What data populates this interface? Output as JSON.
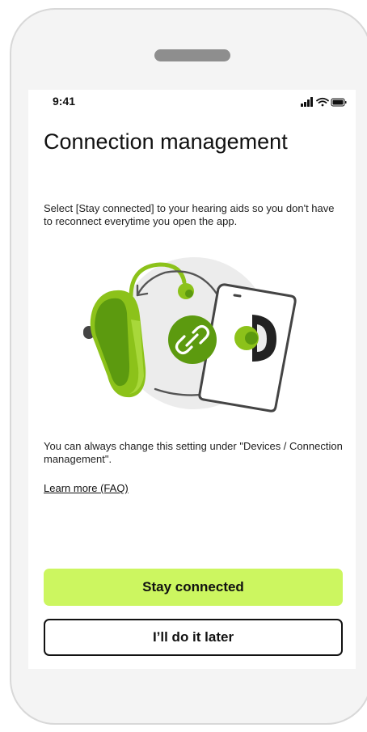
{
  "status_bar": {
    "time": "9:41",
    "icons": [
      "signal-icon",
      "wifi-icon",
      "battery-icon"
    ]
  },
  "screen": {
    "title": "Connection management",
    "description": "Select [Stay connected] to your hearing aids so you don't have to reconnect everytime you open the app.",
    "illustration_icons": [
      "hearing-aid-icon",
      "link-icon",
      "phone-icon"
    ],
    "hint": "You can always change this setting under \"Devices / Connection management\".",
    "faq_link": "Learn more (FAQ)"
  },
  "actions": {
    "primary": "Stay connected",
    "secondary": "I’ll do it later"
  },
  "colors": {
    "accent": "#ccf660",
    "brand_green": "#8cc21a",
    "dark_green": "#5c9a0f",
    "text": "#111111"
  }
}
